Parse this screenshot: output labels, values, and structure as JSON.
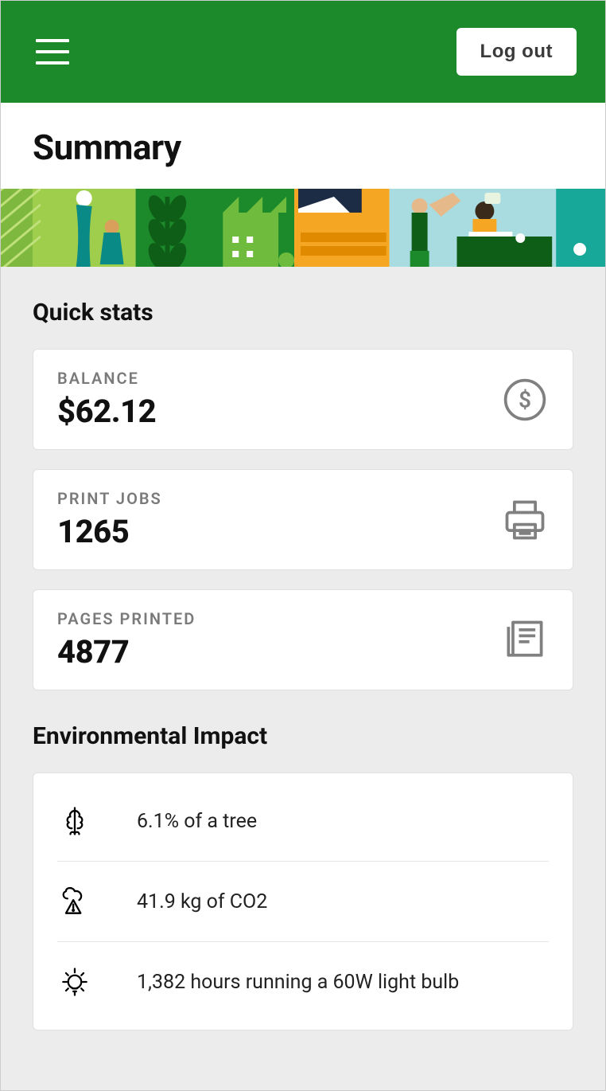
{
  "header": {
    "logout_label": "Log out"
  },
  "page": {
    "title": "Summary"
  },
  "quick_stats": {
    "section_title": "Quick stats",
    "balance": {
      "label": "BALANCE",
      "value": "$62.12"
    },
    "print_jobs": {
      "label": "PRINT JOBS",
      "value": "1265"
    },
    "pages_printed": {
      "label": "PAGES PRINTED",
      "value": "4877"
    }
  },
  "environmental": {
    "section_title": "Environmental Impact",
    "tree": "6.1% of a tree",
    "co2": "41.9 kg of CO2",
    "lightbulb": "1,382 hours running a 60W light bulb"
  }
}
